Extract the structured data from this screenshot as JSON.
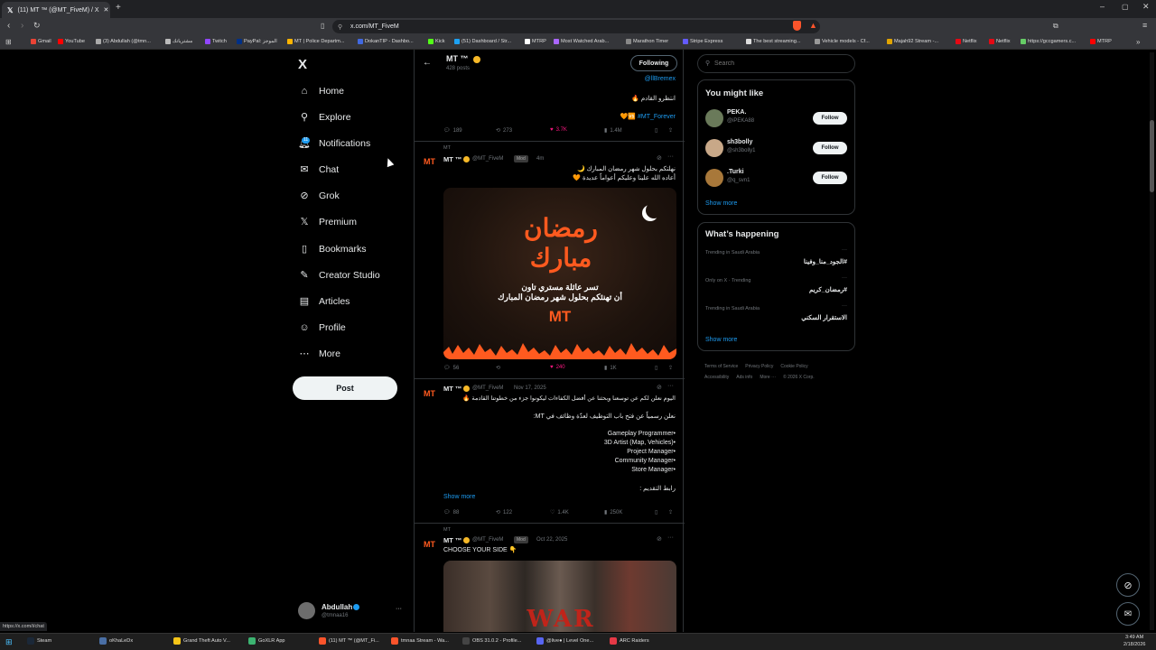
{
  "browser": {
    "tab_title": "(11) MT ™ (@MT_FiveM) / X",
    "url": "x.com/MT_FiveM",
    "status_url": "https://x.com/i/chat"
  },
  "bookmarks": [
    "Gmail",
    "YouTube",
    "(3) Abdullah (@tmn...",
    "مشترياتك",
    "Twitch",
    "PayPal: الموجز",
    "MT | Police Departm...",
    "DokanTIP - Dashbo...",
    "Kick",
    "(51) Dashboard / Str...",
    "MTRP",
    "Most Watched Arab...",
    "Marathon Timer",
    "Stripe Express",
    "The best streaming...",
    "Vehicle models - Cf...",
    "Majah92 Stream -...",
    "Netflix",
    "Netflix",
    "https://gccgamers.c...",
    "MTRP"
  ],
  "nav": {
    "logo": "X",
    "items": [
      "Home",
      "Explore",
      "Notifications",
      "Chat",
      "Grok",
      "Premium",
      "Bookmarks",
      "Creator Studio",
      "Articles",
      "Profile",
      "More"
    ],
    "notif_badge": "11",
    "post": "Post",
    "user_name": "Abdullah",
    "user_handle": "@tmnaa16",
    "more_dots": "···"
  },
  "header": {
    "name": "MT ™",
    "posts": "428 posts",
    "following": "Following"
  },
  "post0": {
    "mention": "@llBremex",
    "text1": "انتظرو القادم 🔥",
    "hashtag": "🧡🆚 #MT_Forever",
    "replies": "189",
    "reposts": "273",
    "likes": "3.7K",
    "views": "1.4M"
  },
  "post1": {
    "pinned": "MT",
    "name": "MT ™",
    "handle": "@MT_FiveM",
    "badge": "Mod",
    "time": "4m",
    "line1": "نهلتكم بحلول شهر رمضان المبارك 🌙",
    "line2": "أعاده الله علينا وعليكم أعواماً عديدة 🧡",
    "img_title": "رمضان مبارك",
    "img_line1": "تسر عائلة مستري تاون",
    "img_line2": "أن تهنئكم بحلول شهر رمضان المبارك",
    "img_logo": "MT",
    "replies": "56",
    "reposts": "",
    "likes": "240",
    "views": "1K"
  },
  "post2": {
    "name": "MT ™",
    "handle": "@MT_FiveM",
    "time": "Nov 17, 2025",
    "line1": "اليوم نعلن لكم عن توسعنا وبحثنا عن أفضل الكفاءات ليكونوا جزء من خطوتنا القادمة 🔥",
    "line2": "نعلن رسمياً عن فتح باب التوظيف لعدّة وظائف في MT:",
    "jobs": [
      "Gameplay Programmer•",
      "3D Artist (Map, Vehicles)•",
      "Project Manager•",
      "Community Manager•",
      "Store Manager•"
    ],
    "apply": "رابط التقديم :",
    "show_more": "Show more",
    "replies": "88",
    "reposts": "122",
    "likes": "1.4K",
    "views": "250K"
  },
  "post3": {
    "pinned": "MT",
    "name": "MT ™",
    "handle": "@MT_FiveM",
    "badge": "Mod",
    "time": "Oct 22, 2025",
    "text": "CHOOSE YOUR SIDE 👇",
    "img_text": "WAR"
  },
  "search": {
    "placeholder": "Search"
  },
  "might_like": {
    "title": "You might like",
    "users": [
      {
        "name": "PEKA.",
        "handle": "@iPEKA88",
        "btn": "Follow"
      },
      {
        "name": "sh3bolly",
        "handle": "@sh3bolly1",
        "btn": "Follow"
      },
      {
        "name": ".Turki",
        "handle": "@q_svn1",
        "btn": "Follow"
      }
    ],
    "show_more": "Show more"
  },
  "happening": {
    "title": "What’s happening",
    "trends": [
      {
        "ctx": "Trending in Saudi Arabia",
        "tag": "#الجود_منا_وفينا"
      },
      {
        "ctx": "Only on X · Trending",
        "tag": "#رمضان_كريم"
      },
      {
        "ctx": "Trending in Saudi Arabia",
        "tag": "الاستقرار السكني"
      }
    ],
    "show_more": "Show more"
  },
  "footer": [
    "Terms of Service",
    "Privacy Policy",
    "Cookie Policy",
    "Accessibility",
    "Ads info",
    "More ···",
    "© 2026 X Corp."
  ],
  "taskbar": {
    "apps": [
      "Steam",
      "oKhaLeDx",
      "Grand Theft Auto V...",
      "GoXLR App",
      "(11) MT ™ (@MT_Fi...",
      "tmnaa Stream - Wa...",
      "OBS 31.0.2 - Profile...",
      "@live● | Level One...",
      "ARC Raiders"
    ],
    "time": "3:49 AM",
    "date": "2/18/2026"
  },
  "colors": {
    "accent": "#1d9bf0",
    "like": "#f91880",
    "verified": "#f7b928",
    "orange": "#ff5a1f"
  }
}
